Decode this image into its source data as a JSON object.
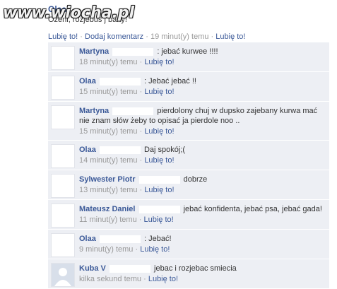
{
  "watermark": "www.wiocha.pl",
  "post": {
    "author": "Olaa",
    "text": "Ożeni, rozjebus j bany!",
    "like": "Lubię to!",
    "comment": "Dodaj komentarz",
    "time": "19 minut(y) temu",
    "like2": "Lubię to!"
  },
  "comments": [
    {
      "name": "Martyna",
      "text": ": jebać kurwee !!!!",
      "time": "18 minut(y) temu",
      "like": "Lubię to!"
    },
    {
      "name": "Olaa",
      "text": ": Jebać jebać !!",
      "time": "15 minut(y) temu",
      "like": "Lubię to!"
    },
    {
      "name": "Martyna",
      "text": "pierdolony chuj w dupsko zajebany kurwa mać nie znam słów żeby to opisać ja pierdole noo ..",
      "time": "15 minut(y) temu",
      "like": "Lubię to!"
    },
    {
      "name": "Olaa",
      "text": "Daj spokój;(",
      "time": "14 minut(y) temu",
      "like": "Lubię to!"
    },
    {
      "name": "Sylwester Piotr",
      "text": "dobrze",
      "time": "13 minut(y) temu",
      "like": "Lubię to!"
    },
    {
      "name": "Mateusz Daniel",
      "text": "jebać konfidenta, jebać psa, jebać gada!",
      "time": "11 minut(y) temu",
      "like": "Lubię to!"
    },
    {
      "name": "Olaa",
      "text": ": Jebać!",
      "time": "9 minut(y) temu",
      "like": "Lubię to!"
    },
    {
      "name": "Kuba V",
      "text": "jebac i rozjebac smiecia",
      "time": "kilka sekund temu",
      "like": "Lubię to!"
    }
  ]
}
